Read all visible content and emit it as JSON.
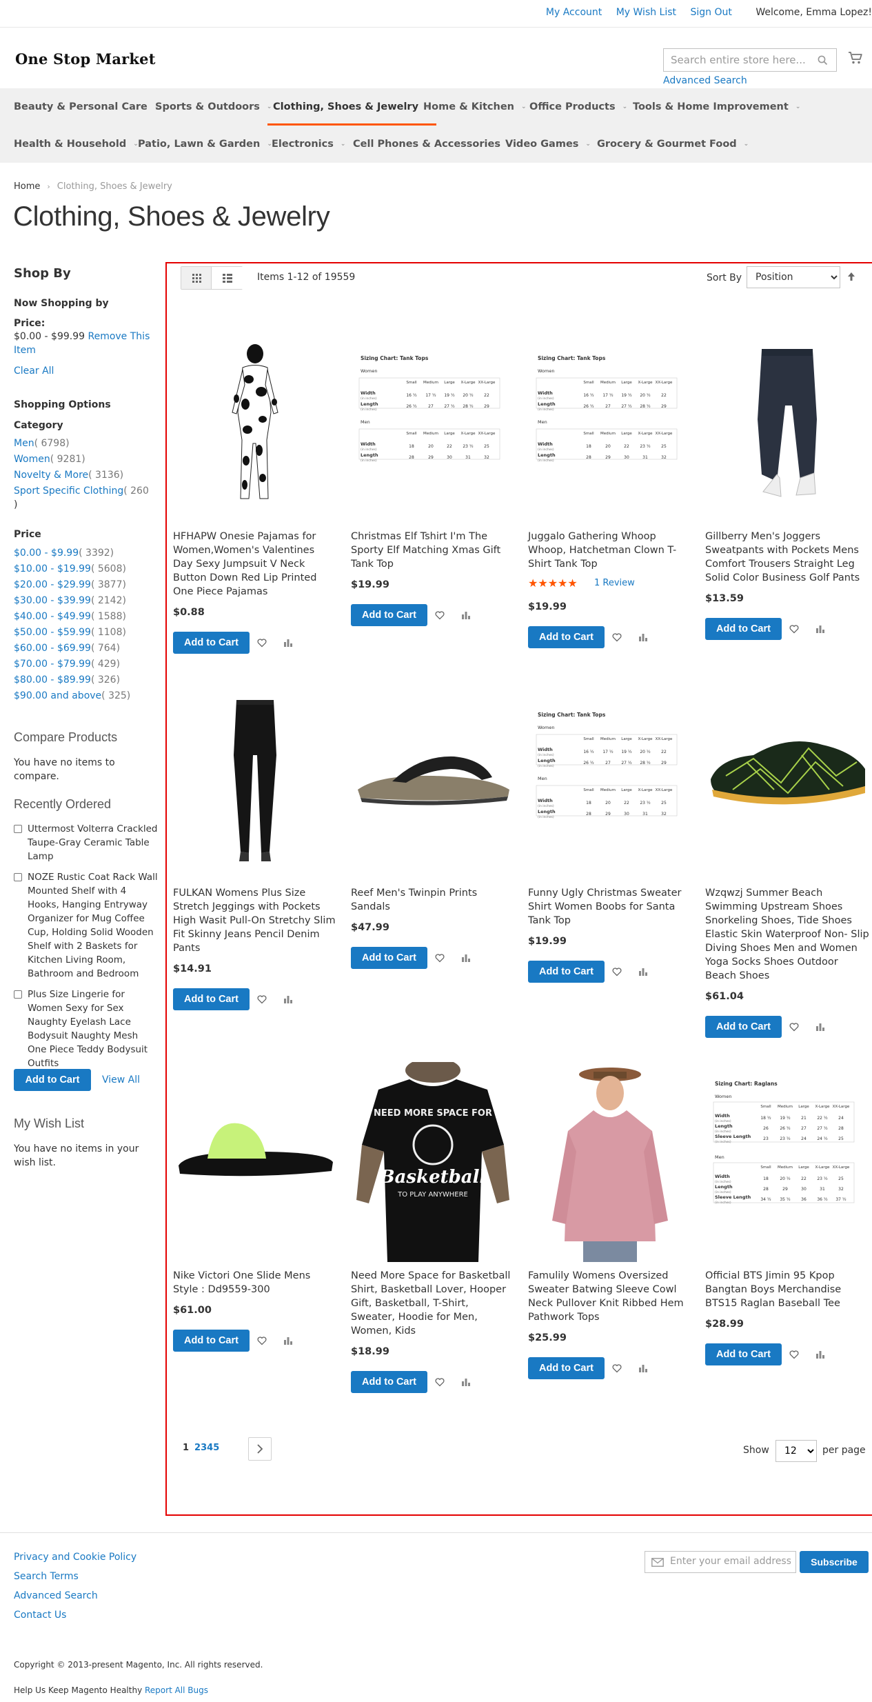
{
  "header": {
    "links": [
      "My Account",
      "My Wish List",
      "Sign Out"
    ],
    "welcome": "Welcome, Emma Lopez!",
    "logo": "One Stop Market",
    "search_placeholder": "Search entire store here...",
    "advanced_search": "Advanced Search"
  },
  "nav": {
    "row1": [
      "Beauty & Personal Care",
      "Sports & Outdoors",
      "Clothing, Shoes & Jewelry",
      "Home & Kitchen",
      "Office Products",
      "Tools & Home Improvement"
    ],
    "row2": [
      "Health & Household",
      "Patio, Lawn & Garden",
      "Electronics",
      "Cell Phones & Accessories",
      "Video Games",
      "Grocery & Gourmet Food"
    ],
    "active": "Clothing, Shoes & Jewelry"
  },
  "breadcrumb": {
    "home": "Home",
    "current": "Clothing, Shoes & Jewelry"
  },
  "page_title": "Clothing, Shoes & Jewelry",
  "sidebar": {
    "shop_by": "Shop By",
    "now_shopping": "Now Shopping by",
    "filter_label": "Price:",
    "filter_value": "$0.00 - $99.99",
    "remove_label": "Remove This",
    "remove_label2": "Item",
    "clear_all": "Clear All",
    "shopping_options": "Shopping Options",
    "category_title": "Category",
    "categories": [
      {
        "label": "Men",
        "count": "( 6798)"
      },
      {
        "label": "Women",
        "count": "( 9281)"
      },
      {
        "label": "Novelty & More",
        "count": "( 3136)"
      },
      {
        "label": "Sport Specific Clothing",
        "count": "( 260"
      }
    ],
    "category_tail": ")",
    "price_title": "Price",
    "prices": [
      {
        "label": "$0.00 - $9.99",
        "count": "( 3392)"
      },
      {
        "label": "$10.00 - $19.99",
        "count": "( 5608)"
      },
      {
        "label": "$20.00 - $29.99",
        "count": "( 3877)"
      },
      {
        "label": "$30.00 - $39.99",
        "count": "( 2142)"
      },
      {
        "label": "$40.00 - $49.99",
        "count": "( 1588)"
      },
      {
        "label": "$50.00 - $59.99",
        "count": "( 1108)"
      },
      {
        "label": "$60.00 - $69.99",
        "count": "( 764)"
      },
      {
        "label": "$70.00 - $79.99",
        "count": "( 429)"
      },
      {
        "label": "$80.00 - $89.99",
        "count": "( 326)"
      },
      {
        "label": "$90.00 and above",
        "count": "( 325)"
      }
    ],
    "compare_title": "Compare Products",
    "compare_empty": "You have no items to compare.",
    "recent_title": "Recently Ordered",
    "recent_items": [
      "Uttermost Volterra Crackled Taupe-Gray Ceramic Table Lamp",
      "NOZE Rustic Coat Rack Wall Mounted Shelf with 4 Hooks, Hanging Entryway Organizer for Mug Coffee Cup, Holding Solid Wooden Shelf with 2 Baskets for Kitchen Living Room, Bathroom and Bedroom",
      "Plus Size Lingerie for Women Sexy for Sex Naughty Eyelash Lace Bodysuit Naughty Mesh One Piece Teddy Bodysuit Outfits"
    ],
    "add_to_cart": "Add to Cart",
    "view_all": "View All",
    "wish_title": "My Wish List",
    "wish_empty": "You have no items in your wish list."
  },
  "toolbar": {
    "amount": "Items 1-12 of 19559",
    "sort_label": "Sort By",
    "sort_value": "Position",
    "show_label": "Show",
    "limit_value": "12",
    "per_page": "per page"
  },
  "products": [
    {
      "name": "HFHAPW Onesie Pajamas for Women,Women's Valentines Day Sexy Jumpsuit V Neck Button Down Red Lip Printed One Piece Pajamas",
      "price": "$0.88",
      "image": "onesie-cow-print"
    },
    {
      "name": "Christmas Elf Tshirt I'm The Sporty Elf Matching Xmas Gift Tank Top",
      "price": "$19.99",
      "image": "size-chart-tank-tops"
    },
    {
      "name": "Juggalo Gathering Whoop Whoop, Hatchetman Clown T-Shirt Tank Top",
      "price": "$19.99",
      "image": "size-chart-tank-tops",
      "rating": 5,
      "reviews": "1  Review"
    },
    {
      "name": "Gillberry Men's Joggers Sweatpants with Pockets Mens Comfort Trousers Straight Leg Solid Color Business Golf Pants",
      "price": "$13.59",
      "image": "navy-joggers"
    },
    {
      "name": "FULKAN Womens Plus Size Stretch Jeggings with Pockets High Wasit Pull-On Stretchy Slim Fit Skinny Jeans Pencil Denim Pants",
      "price": "$14.91",
      "image": "black-jeggings"
    },
    {
      "name": "Reef Men's Twinpin Prints Sandals",
      "price": "$47.99",
      "image": "flip-flop-sandal"
    },
    {
      "name": "Funny Ugly Christmas Sweater Shirt Women Boobs for Santa Tank Top",
      "price": "$19.99",
      "image": "size-chart-tank-tops"
    },
    {
      "name": "Wzqwzj Summer Beach Swimming Upstream Shoes Snorkeling Shoes, Tide Shoes Elastic Skin Waterproof Non- Slip Diving Shoes Men and Women Yoga Socks Shoes Outdoor Beach Shoes",
      "price": "$61.04",
      "image": "water-shoe"
    },
    {
      "name": "Nike Victori One Slide Mens Style : Dd9559-300",
      "price": "$61.00",
      "image": "green-slide"
    },
    {
      "name": "Need More Space for Basketball Shirt, Basketball Lover, Hooper Gift, Basketball, T-Shirt, Sweater, Hoodie for Men, Women, Kids",
      "price": "$18.99",
      "image": "basketball-tshirt"
    },
    {
      "name": "Famulily Womens Oversized Sweater Batwing Sleeve Cowl Neck Pullover Knit Ribbed Hem Pathwork Tops",
      "price": "$25.99",
      "image": "pink-sweater"
    },
    {
      "name": "Official BTS Jimin 95 Kpop Bangtan Boys Merchandise BTS15 Raglan Baseball Tee",
      "price": "$28.99",
      "image": "size-chart-raglans"
    }
  ],
  "product_button": "Add to Cart",
  "size_chart": {
    "tank_title": "Sizing Chart: Tank Tops",
    "raglan_title": "Sizing Chart: Raglans",
    "women": "Women",
    "men": "Men",
    "sizes": [
      "Small",
      "Medium",
      "Large",
      "X-Large",
      "XX-Large"
    ],
    "width": "Width",
    "length": "Length",
    "sleeve": "Sleeve Length",
    "inches": "(in inches)",
    "w_width": [
      "16 ½",
      "17 ½",
      "19 ½",
      "20 ½",
      "22"
    ],
    "w_length": [
      "26 ½",
      "27",
      "27 ½",
      "28 ½",
      "29"
    ],
    "m_width": [
      "18",
      "20",
      "22",
      "23 ½",
      "25"
    ],
    "m_length": [
      "28",
      "29",
      "30",
      "31",
      "32"
    ],
    "r_w_width": [
      "18 ½",
      "19 ½",
      "21",
      "22 ½",
      "24"
    ],
    "r_w_length": [
      "26",
      "26 ½",
      "27",
      "27 ½",
      "28"
    ],
    "r_w_sleeve": [
      "23",
      "23 ½",
      "24",
      "24 ½",
      "25"
    ],
    "r_m_width": [
      "18",
      "20 ½",
      "22",
      "23 ½",
      "25"
    ],
    "r_m_length": [
      "28",
      "29",
      "30",
      "31",
      "32"
    ],
    "r_m_sleeve": [
      "34 ½",
      "35 ½",
      "36",
      "36 ½",
      "37 ½"
    ]
  },
  "tshirt_print": {
    "line1": "NEED MORE SPACE FOR",
    "line2": "Basketball",
    "line3": "TO PLAY ANYWHERE"
  },
  "pagination": {
    "pages": [
      "1",
      "2",
      "3",
      "4",
      "5"
    ]
  },
  "footer": {
    "links": [
      "Privacy and Cookie Policy",
      "Search Terms",
      "Advanced Search",
      "Contact Us"
    ],
    "newsletter_placeholder": "Enter your email address",
    "subscribe": "Subscribe",
    "copyright": "Copyright © 2013-present Magento, Inc. All rights reserved.",
    "help": "Help Us Keep Magento Healthy",
    "report": "Report All Bugs"
  },
  "colors": {
    "link": "#1979c3",
    "accent": "#ff5501",
    "frame": "#e40000",
    "nav_bg": "#f0f0f0"
  }
}
